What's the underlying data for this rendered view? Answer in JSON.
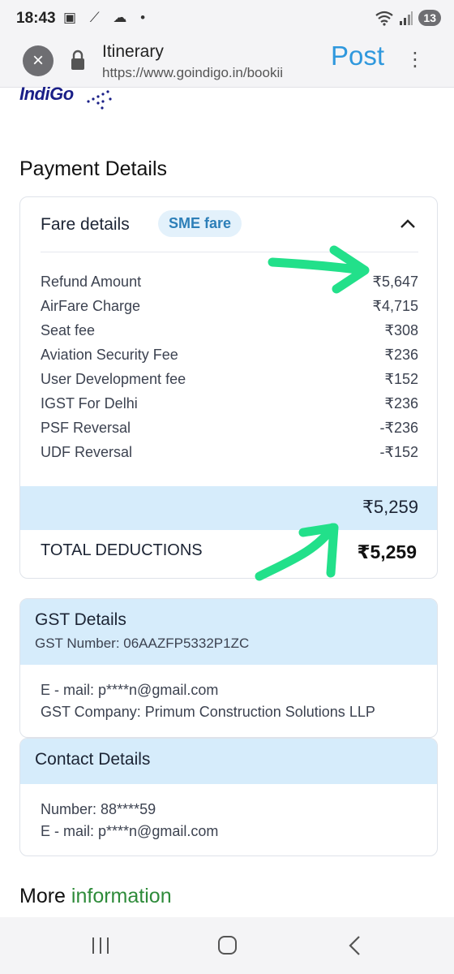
{
  "status_bar": {
    "time": "18:43",
    "notification_icons": "▣ ⟋ ☁ •",
    "battery_level": "13"
  },
  "browser": {
    "title": "Itinerary",
    "url": "https://www.goindigo.in/bookii",
    "post_label": "Post",
    "close_symbol": "×",
    "menu_symbol": "⋮"
  },
  "logo": {
    "text": "IndiGo"
  },
  "payment": {
    "section_title": "Payment Details",
    "fare_header": "Fare details",
    "fare_badge": "SME fare",
    "rows": [
      {
        "label": "Refund Amount",
        "amount": "₹5,647"
      },
      {
        "label": "AirFare Charge",
        "amount": "₹4,715"
      },
      {
        "label": "Seat fee",
        "amount": "₹308"
      },
      {
        "label": "Aviation Security Fee",
        "amount": "₹236"
      },
      {
        "label": "User Development fee",
        "amount": "₹152"
      },
      {
        "label": "IGST For Delhi",
        "amount": "₹236"
      },
      {
        "label": "PSF Reversal",
        "amount": "-₹236"
      },
      {
        "label": "UDF Reversal",
        "amount": "-₹152"
      }
    ],
    "total": "₹5,259",
    "deductions_label": "TOTAL DEDUCTIONS",
    "deductions_amount": "₹5,259"
  },
  "gst": {
    "title": "GST Details",
    "number_line": "GST Number: 06AAZFP5332P1ZC",
    "email_line": "E - mail: p****n@gmail.com",
    "company_line": "GST Company: Primum Construction Solutions LLP"
  },
  "contact": {
    "title": "Contact Details",
    "number_line": "Number: 88****59",
    "email_line": "E - mail: p****n@gmail.com"
  },
  "more_information": {
    "word_1": "More",
    "word_2": "information"
  },
  "colors": {
    "accent_blue": "#2f98dd",
    "highlight_band": "#d6ecfb",
    "annotation_green": "#22e08a",
    "logo_navy": "#1a1f87"
  }
}
